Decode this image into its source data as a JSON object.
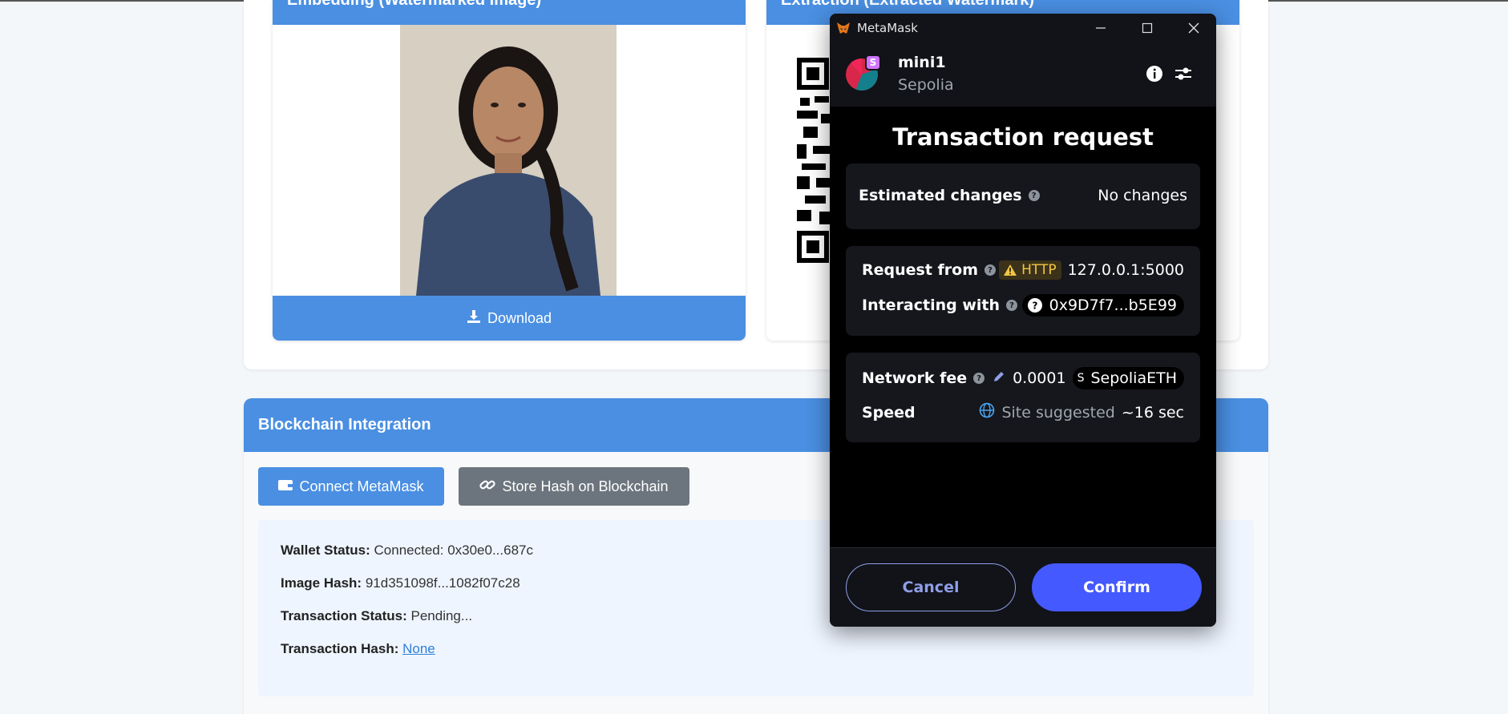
{
  "embedding_panel": {
    "title": "Embedding (Watermarked Image)",
    "download_label": "Download"
  },
  "extraction_panel": {
    "title": "Extraction (Extracted Watermark)"
  },
  "blockchain": {
    "title": "Blockchain Integration",
    "connect_label": "Connect MetaMask",
    "store_label": "Store Hash on Blockchain",
    "wallet_status_label": "Wallet Status:",
    "wallet_status_value": "Connected: 0x30e0...687c",
    "image_hash_label": "Image Hash:",
    "image_hash_value": "91d351098f...1082f07c28",
    "tx_status_label": "Transaction Status:",
    "tx_status_value": "Pending...",
    "tx_hash_label": "Transaction Hash:",
    "tx_hash_value": "None"
  },
  "metamask": {
    "window_title": "MetaMask",
    "account_name": "mini1",
    "network_name": "Sepolia",
    "network_badge": "S",
    "heading": "Transaction request",
    "estimated_changes_label": "Estimated changes",
    "estimated_changes_value": "No changes",
    "request_from_label": "Request from",
    "http_badge": "HTTP",
    "request_from_value": "127.0.0.1:5000",
    "interacting_with_label": "Interacting with",
    "interacting_with_value": "0x9D7f7...b5E99",
    "network_fee_label": "Network fee",
    "network_fee_value": "0.0001",
    "network_fee_token_badge": "S",
    "network_fee_token": "SepoliaETH",
    "speed_label": "Speed",
    "speed_source": "Site suggested",
    "speed_value": "~16 sec",
    "cancel_label": "Cancel",
    "confirm_label": "Confirm"
  },
  "colors": {
    "primary_blue": "#4a8fe2",
    "gray_button": "#6c757d",
    "metamask_confirm": "#4459ff",
    "metamask_bg": "#000000"
  }
}
